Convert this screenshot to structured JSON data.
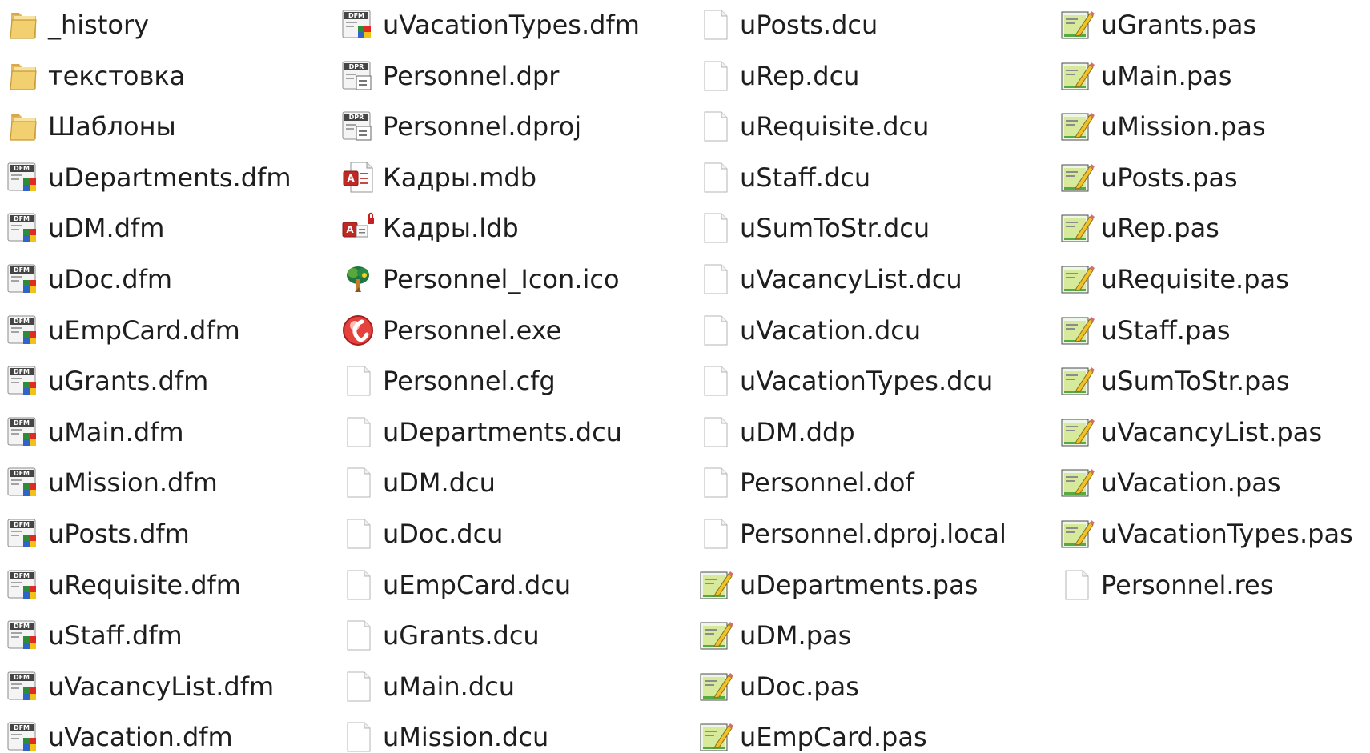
{
  "explorer": {
    "columns": [
      {
        "items": [
          {
            "name": "_history",
            "icon": "folder-icon"
          },
          {
            "name": "текстовка",
            "icon": "folder-icon"
          },
          {
            "name": "Шаблоны",
            "icon": "folder-icon"
          },
          {
            "name": "uDepartments.dfm",
            "icon": "dfm-file-icon"
          },
          {
            "name": "uDM.dfm",
            "icon": "dfm-file-icon"
          },
          {
            "name": "uDoc.dfm",
            "icon": "dfm-file-icon"
          },
          {
            "name": "uEmpCard.dfm",
            "icon": "dfm-file-icon"
          },
          {
            "name": "uGrants.dfm",
            "icon": "dfm-file-icon"
          },
          {
            "name": "uMain.dfm",
            "icon": "dfm-file-icon"
          },
          {
            "name": "uMission.dfm",
            "icon": "dfm-file-icon"
          },
          {
            "name": "uPosts.dfm",
            "icon": "dfm-file-icon"
          },
          {
            "name": "uRequisite.dfm",
            "icon": "dfm-file-icon"
          },
          {
            "name": "uStaff.dfm",
            "icon": "dfm-file-icon"
          },
          {
            "name": "uVacancyList.dfm",
            "icon": "dfm-file-icon"
          },
          {
            "name": "uVacation.dfm",
            "icon": "dfm-file-icon"
          }
        ]
      },
      {
        "items": [
          {
            "name": "uVacationTypes.dfm",
            "icon": "dfm-file-icon"
          },
          {
            "name": "Personnel.dpr",
            "icon": "dpr-file-icon"
          },
          {
            "name": "Personnel.dproj",
            "icon": "dpr-file-icon"
          },
          {
            "name": "Кадры.mdb",
            "icon": "access-database-icon"
          },
          {
            "name": "Кадры.ldb",
            "icon": "access-lock-icon"
          },
          {
            "name": "Personnel_Icon.ico",
            "icon": "tree-icon"
          },
          {
            "name": "Personnel.exe",
            "icon": "exe-icon"
          },
          {
            "name": "Personnel.cfg",
            "icon": "blank-file-icon"
          },
          {
            "name": "uDepartments.dcu",
            "icon": "blank-file-icon"
          },
          {
            "name": "uDM.dcu",
            "icon": "blank-file-icon"
          },
          {
            "name": "uDoc.dcu",
            "icon": "blank-file-icon"
          },
          {
            "name": "uEmpCard.dcu",
            "icon": "blank-file-icon"
          },
          {
            "name": "uGrants.dcu",
            "icon": "blank-file-icon"
          },
          {
            "name": "uMain.dcu",
            "icon": "blank-file-icon"
          },
          {
            "name": "uMission.dcu",
            "icon": "blank-file-icon"
          }
        ]
      },
      {
        "items": [
          {
            "name": "uPosts.dcu",
            "icon": "blank-file-icon"
          },
          {
            "name": "uRep.dcu",
            "icon": "blank-file-icon"
          },
          {
            "name": "uRequisite.dcu",
            "icon": "blank-file-icon"
          },
          {
            "name": "uStaff.dcu",
            "icon": "blank-file-icon"
          },
          {
            "name": "uSumToStr.dcu",
            "icon": "blank-file-icon"
          },
          {
            "name": "uVacancyList.dcu",
            "icon": "blank-file-icon"
          },
          {
            "name": "uVacation.dcu",
            "icon": "blank-file-icon"
          },
          {
            "name": "uVacationTypes.dcu",
            "icon": "blank-file-icon"
          },
          {
            "name": "uDM.ddp",
            "icon": "blank-file-icon"
          },
          {
            "name": "Personnel.dof",
            "icon": "blank-file-icon"
          },
          {
            "name": "Personnel.dproj.local",
            "icon": "blank-file-icon"
          },
          {
            "name": "uDepartments.pas",
            "icon": "pas-file-icon"
          },
          {
            "name": "uDM.pas",
            "icon": "pas-file-icon"
          },
          {
            "name": "uDoc.pas",
            "icon": "pas-file-icon"
          },
          {
            "name": "uEmpCard.pas",
            "icon": "pas-file-icon"
          }
        ]
      },
      {
        "items": [
          {
            "name": "uGrants.pas",
            "icon": "pas-file-icon"
          },
          {
            "name": "uMain.pas",
            "icon": "pas-file-icon"
          },
          {
            "name": "uMission.pas",
            "icon": "pas-file-icon"
          },
          {
            "name": "uPosts.pas",
            "icon": "pas-file-icon"
          },
          {
            "name": "uRep.pas",
            "icon": "pas-file-icon"
          },
          {
            "name": "uRequisite.pas",
            "icon": "pas-file-icon"
          },
          {
            "name": "uStaff.pas",
            "icon": "pas-file-icon"
          },
          {
            "name": "uSumToStr.pas",
            "icon": "pas-file-icon"
          },
          {
            "name": "uVacancyList.pas",
            "icon": "pas-file-icon"
          },
          {
            "name": "uVacation.pas",
            "icon": "pas-file-icon"
          },
          {
            "name": "uVacationTypes.pas",
            "icon": "pas-file-icon"
          },
          {
            "name": "Personnel.res",
            "icon": "blank-file-icon"
          }
        ]
      }
    ]
  }
}
